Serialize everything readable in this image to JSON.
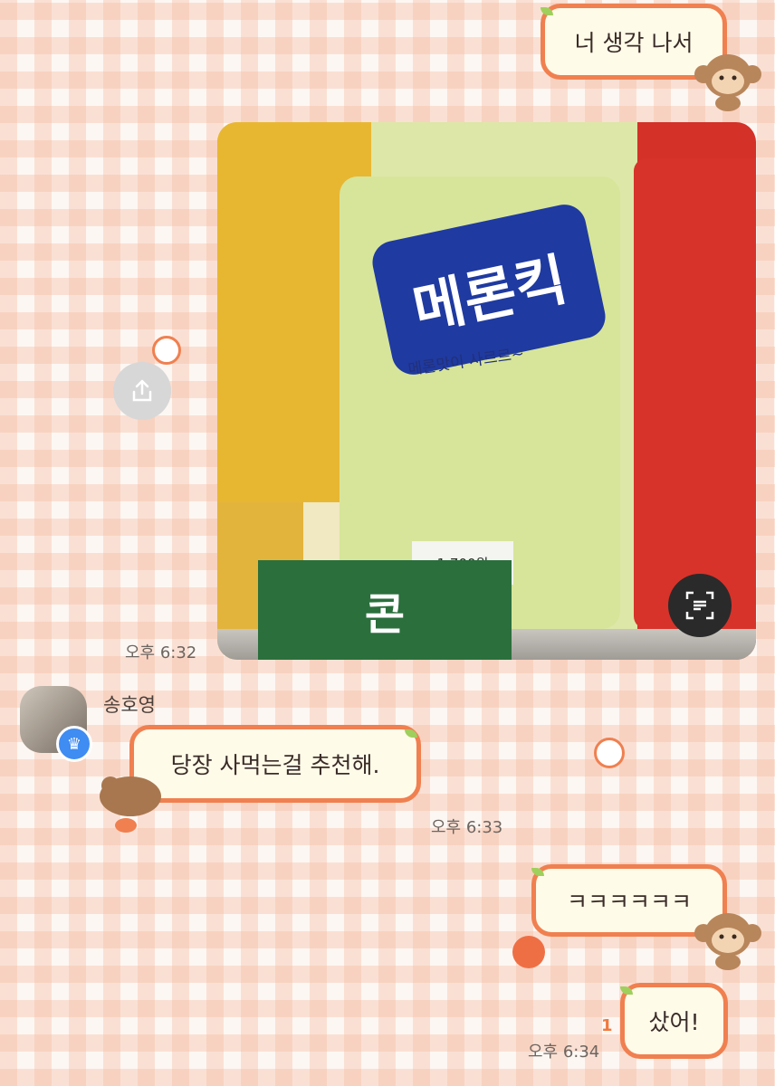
{
  "messages": {
    "m1_text": "너 생각 나서",
    "photo_time": "오후 6:32",
    "sender_name": "송호영",
    "m2_text": "당장 사먹는걸 추천해.",
    "m2_time": "오후 6:33",
    "m3_text": "ㅋㅋㅋㅋㅋㅋ",
    "m4_text": "샀어!",
    "m4_unread": "1",
    "m4_time": "오후 6:34"
  },
  "photo": {
    "snack_logo": "메론킥",
    "snack_tagline": "메론맛이 사르르~",
    "price_tag": "1,700원",
    "bottom_snack": "콘"
  },
  "icons": {
    "upload": "share-upload-icon",
    "scan": "text-scan-icon",
    "monkey": "monkey-sticker-icon",
    "apple": "apple-sticker-icon",
    "crown": "crown-badge-icon"
  },
  "colors": {
    "bubble_border": "#f08050",
    "bubble_fill": "#fffbe9",
    "crown_badge": "#3f8cf2"
  }
}
